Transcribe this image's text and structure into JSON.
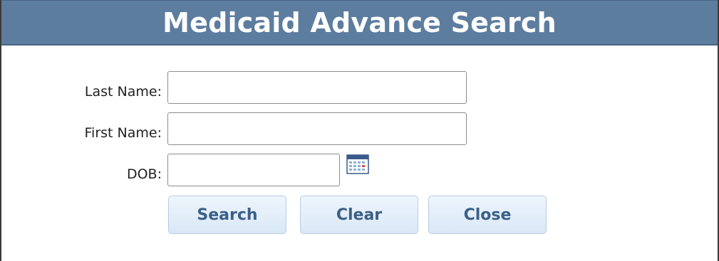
{
  "dialog": {
    "title": "Medicaid Advance Search"
  },
  "form": {
    "last_name": {
      "label": "Last Name:",
      "value": ""
    },
    "first_name": {
      "label": "First Name:",
      "value": ""
    },
    "dob": {
      "label": "DOB:",
      "value": "",
      "icon": "calendar-icon"
    }
  },
  "buttons": {
    "search": "Search",
    "clear": "Clear",
    "close": "Close"
  },
  "colors": {
    "titlebar": "#5d7d9f",
    "button_text": "#3b5f87",
    "button_bg": "#e3eef9"
  }
}
